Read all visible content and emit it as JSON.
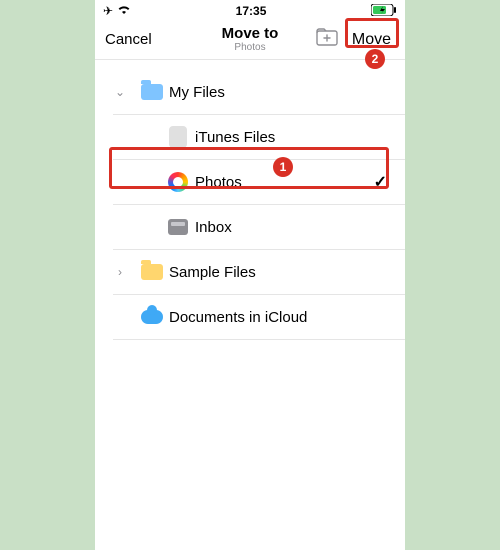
{
  "status": {
    "time": "17:35"
  },
  "nav": {
    "cancel": "Cancel",
    "title": "Move to",
    "subtitle": "Photos",
    "move": "Move"
  },
  "rows": {
    "myfiles": "My Files",
    "itunes": "iTunes Files",
    "photos": "Photos",
    "inbox": "Inbox",
    "sample": "Sample Files",
    "icloud": "Documents in iCloud"
  },
  "annotations": {
    "row_badge": "1",
    "move_badge": "2"
  },
  "check_mark": "✓"
}
